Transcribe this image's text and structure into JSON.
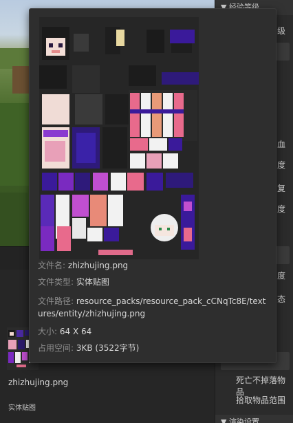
{
  "popup": {
    "file_name_label": "文件名:",
    "file_name": "zhizhujing.png",
    "file_type_label": "文件类型:",
    "file_type": "实体贴图",
    "file_path_label": "文件路径:",
    "file_path": "resource_packs/resource_pack_cCNqTc8E/textures/entity/zhizhujing.png",
    "size_label": "大小:",
    "size": "64 X 64",
    "space_label": "占用空间:",
    "space": "3KB (3522字节)"
  },
  "asset": {
    "name": "zhizhujing.png",
    "type": "实体贴图"
  },
  "right_panel": {
    "section_top": "经验等级",
    "level_char": "级",
    "chars": [
      "血",
      "度",
      "复",
      "度",
      "度",
      "态"
    ],
    "item_no_drop": "死亡不掉落物品",
    "item_pickup_range": "拾取物品范围",
    "section_bottom": "渲染设置"
  },
  "colors": {
    "panel_bg": "#2e2e2e",
    "accent_purple": "#5b2bbf",
    "accent_pink": "#e8708a"
  }
}
